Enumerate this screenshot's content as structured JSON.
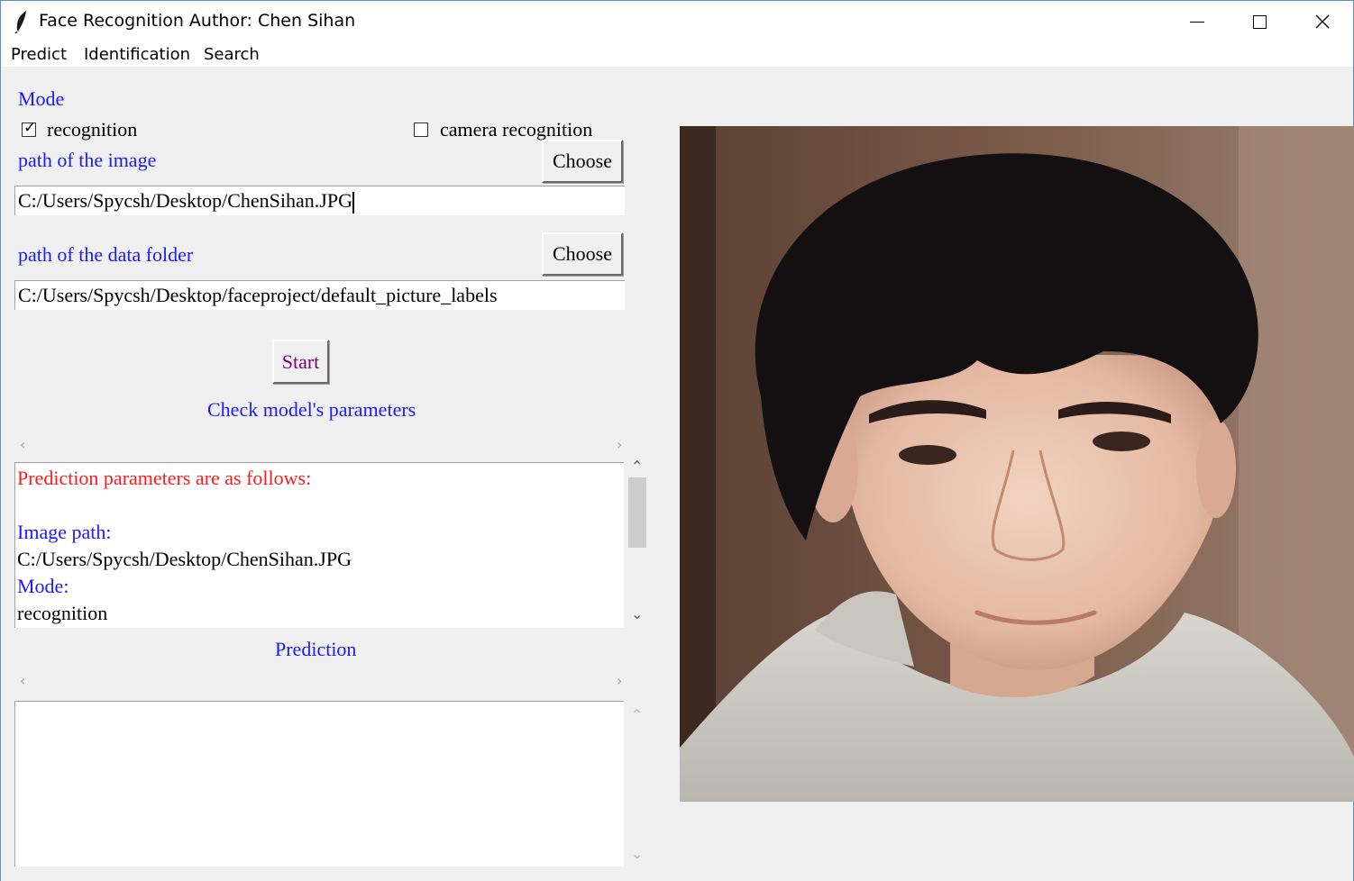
{
  "window": {
    "title": "Face Recognition Author: Chen Sihan"
  },
  "menu": [
    "Predict",
    "Identification",
    "Search"
  ],
  "mode": {
    "heading": "Mode",
    "recognition_label": "recognition",
    "recognition_checked": true,
    "camera_label": "camera recognition",
    "camera_checked": false
  },
  "image_path": {
    "label": "path of the image",
    "choose_label": "Choose",
    "value": "C:/Users/Spycsh/Desktop/ChenSihan.JPG"
  },
  "data_folder": {
    "label": "path of the data folder",
    "choose_label": "Choose",
    "value": "C:/Users/Spycsh/Desktop/faceproject/default_picture_labels"
  },
  "start_label": "Start",
  "params": {
    "heading": "Check model's parameters",
    "lines": [
      {
        "text": "Prediction parameters are as follows:",
        "color": "#ff1a1a"
      },
      {
        "text": "",
        "color": "#000000"
      },
      {
        "text": "Image path:",
        "color": "#1a1aff"
      },
      {
        "text": "C:/Users/Spycsh/Desktop/ChenSihan.JPG",
        "color": "#000000"
      },
      {
        "text": "Mode:",
        "color": "#1a1aff"
      },
      {
        "text": "recognition",
        "color": "#000000"
      }
    ]
  },
  "prediction": {
    "heading": "Prediction",
    "text": ""
  },
  "colors": {
    "label_blue": "#1a1aff",
    "start_purple": "#800080",
    "title_border": "#5a8fd6"
  },
  "icons": {
    "app": "feather-icon",
    "minimize": "minimize-icon",
    "maximize": "maximize-icon",
    "close": "close-icon",
    "scroll_left": "chevron-left-icon",
    "scroll_right": "chevron-right-icon",
    "scroll_up": "chevron-up-icon",
    "scroll_down": "chevron-down-icon"
  }
}
